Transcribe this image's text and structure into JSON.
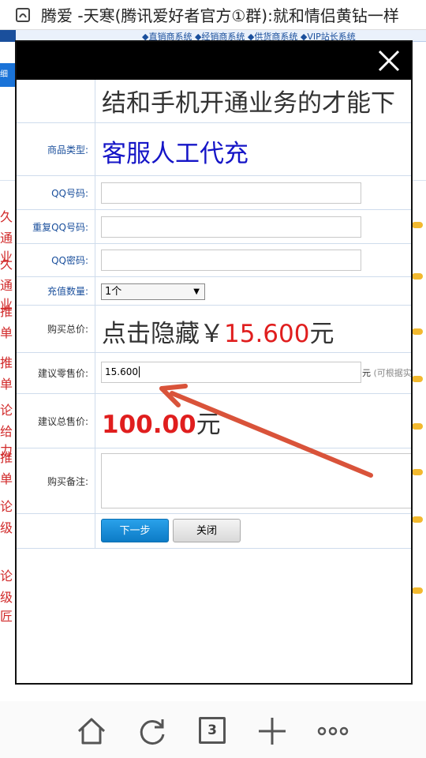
{
  "browser": {
    "title": "腾爱 -天寒(腾讯爱好者官方①群):就和情侣黄钻一样",
    "tab_count": "3"
  },
  "background": {
    "nav_text": "◆直销商系统 ◆经销商系统 ◆供货商系统 ◆VIP站长系统",
    "subbar": "细",
    "rows": [
      "久",
      "通业",
      "久",
      "通业",
      "推",
      "单",
      "推",
      "单",
      "论",
      "给力",
      "推",
      "单",
      "论",
      "级",
      "论",
      "级匠"
    ]
  },
  "form": {
    "top_text": "结和手机开通业务的才能下",
    "product_type_label": "商品类型:",
    "product_type_value": "客服人工代充",
    "qq_label": "QQ号码:",
    "qq_value": "",
    "qq_repeat_label": "重复QQ号码:",
    "qq_repeat_value": "",
    "qq_password_label": "QQ密码:",
    "qq_password_value": "",
    "quantity_label": "充值数量:",
    "quantity_value": "1个",
    "total_label": "购买总价:",
    "total_prefix": "点击隐藏￥",
    "total_amount": "15.600",
    "total_unit": "元",
    "retail_label": "建议零售价:",
    "retail_value": "15.600",
    "retail_unit": "元",
    "retail_hint": "(可根据实",
    "suggest_total_label": "建议总售价:",
    "suggest_total_amount": "100.00",
    "suggest_total_unit": "元",
    "note_label": "购买备注:",
    "note_value": "",
    "next_button": "下一步",
    "close_button": "关闭"
  },
  "colors": {
    "annotation": "#d9533a",
    "primary_button": "#1684d3",
    "price_red": "#e01e1e",
    "product_blue": "#1515c7"
  }
}
